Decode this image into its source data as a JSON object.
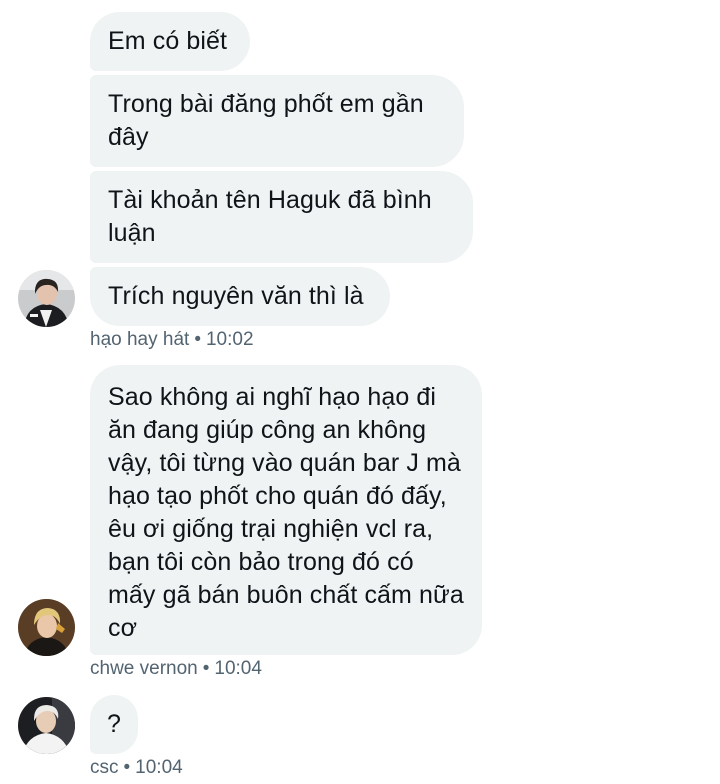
{
  "conversation": {
    "group1": {
      "messages": [
        {
          "text": "Em có biết"
        },
        {
          "text": "Trong bài đăng phốt em gần đây"
        },
        {
          "text": "Tài khoản tên Haguk đã bình luận"
        },
        {
          "text": "Trích nguyên văn thì là"
        }
      ],
      "sender": "hạo hay hát",
      "time": "10:02",
      "avatar": "person-dark-jacket-avatar"
    },
    "group2": {
      "messages": [
        {
          "text": "Sao không ai nghĩ hạo hạo đi ăn đang giúp công an không vậy, tôi từng vào quán bar J mà hạo tạo phốt cho quán đó đấy, êu ơi giống trại nghiện vcl ra, bạn tôi còn bảo trong đó có mấy gã bán buôn chất cấm nữa cơ"
        }
      ],
      "sender": "chwe vernon",
      "time": "10:04",
      "avatar": "person-blond-hair-avatar"
    },
    "group3": {
      "messages": [
        {
          "text": "?"
        }
      ],
      "sender": "csc",
      "time": "10:04",
      "avatar": "person-white-shirt-avatar"
    },
    "separator": "•",
    "colors": {
      "bubble_bg": "#eff3f4",
      "text": "#0f1419",
      "meta": "#536471"
    }
  }
}
